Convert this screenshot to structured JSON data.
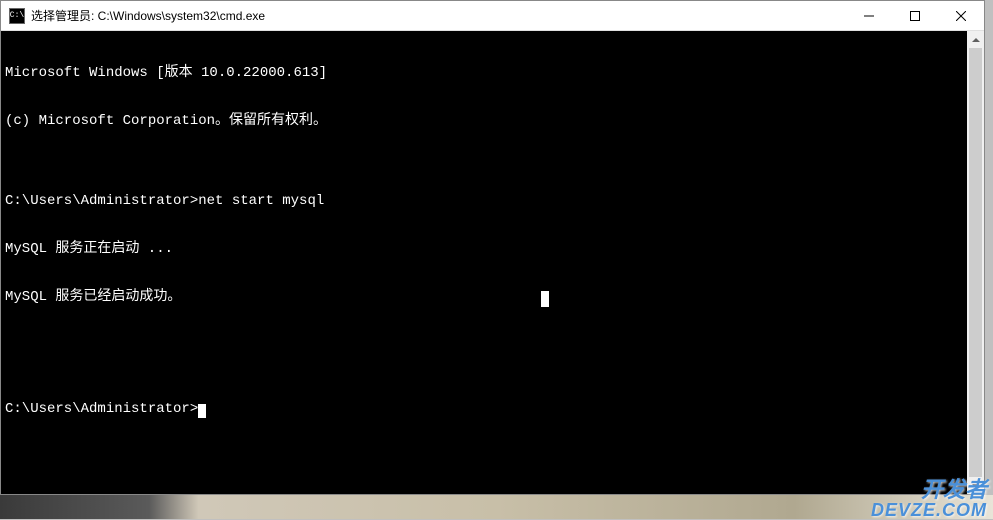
{
  "window": {
    "icon_text": "C:\\",
    "title": "选择管理员: C:\\Windows\\system32\\cmd.exe"
  },
  "terminal": {
    "line1": "Microsoft Windows [版本 10.0.22000.613]",
    "line2": "(c) Microsoft Corporation。保留所有权利。",
    "line3": "",
    "line4_prompt": "C:\\Users\\Administrator>",
    "line4_cmd": "net start mysql",
    "line5": "MySQL 服务正在启动 ...",
    "line6": "MySQL 服务已经启动成功。",
    "line7": "",
    "line8": "",
    "line9_prompt": "C:\\Users\\Administrator>"
  },
  "watermark": {
    "line1": "开发者",
    "line2": "DEVZE.COM"
  }
}
